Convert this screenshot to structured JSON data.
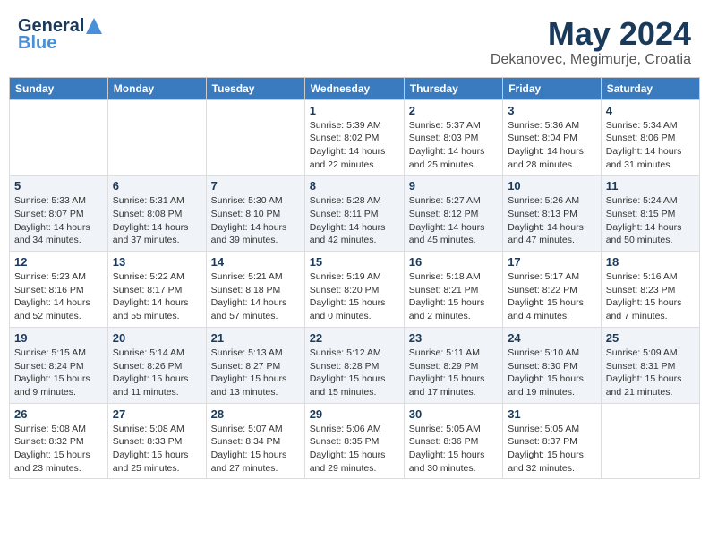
{
  "header": {
    "logo": {
      "line1": "General",
      "line2": "Blue"
    },
    "title": "May 2024",
    "location": "Dekanovec, Megimurje, Croatia"
  },
  "weekdays": [
    "Sunday",
    "Monday",
    "Tuesday",
    "Wednesday",
    "Thursday",
    "Friday",
    "Saturday"
  ],
  "weeks": [
    [
      {
        "day": "",
        "info": ""
      },
      {
        "day": "",
        "info": ""
      },
      {
        "day": "",
        "info": ""
      },
      {
        "day": "1",
        "info": "Sunrise: 5:39 AM\nSunset: 8:02 PM\nDaylight: 14 hours\nand 22 minutes."
      },
      {
        "day": "2",
        "info": "Sunrise: 5:37 AM\nSunset: 8:03 PM\nDaylight: 14 hours\nand 25 minutes."
      },
      {
        "day": "3",
        "info": "Sunrise: 5:36 AM\nSunset: 8:04 PM\nDaylight: 14 hours\nand 28 minutes."
      },
      {
        "day": "4",
        "info": "Sunrise: 5:34 AM\nSunset: 8:06 PM\nDaylight: 14 hours\nand 31 minutes."
      }
    ],
    [
      {
        "day": "5",
        "info": "Sunrise: 5:33 AM\nSunset: 8:07 PM\nDaylight: 14 hours\nand 34 minutes."
      },
      {
        "day": "6",
        "info": "Sunrise: 5:31 AM\nSunset: 8:08 PM\nDaylight: 14 hours\nand 37 minutes."
      },
      {
        "day": "7",
        "info": "Sunrise: 5:30 AM\nSunset: 8:10 PM\nDaylight: 14 hours\nand 39 minutes."
      },
      {
        "day": "8",
        "info": "Sunrise: 5:28 AM\nSunset: 8:11 PM\nDaylight: 14 hours\nand 42 minutes."
      },
      {
        "day": "9",
        "info": "Sunrise: 5:27 AM\nSunset: 8:12 PM\nDaylight: 14 hours\nand 45 minutes."
      },
      {
        "day": "10",
        "info": "Sunrise: 5:26 AM\nSunset: 8:13 PM\nDaylight: 14 hours\nand 47 minutes."
      },
      {
        "day": "11",
        "info": "Sunrise: 5:24 AM\nSunset: 8:15 PM\nDaylight: 14 hours\nand 50 minutes."
      }
    ],
    [
      {
        "day": "12",
        "info": "Sunrise: 5:23 AM\nSunset: 8:16 PM\nDaylight: 14 hours\nand 52 minutes."
      },
      {
        "day": "13",
        "info": "Sunrise: 5:22 AM\nSunset: 8:17 PM\nDaylight: 14 hours\nand 55 minutes."
      },
      {
        "day": "14",
        "info": "Sunrise: 5:21 AM\nSunset: 8:18 PM\nDaylight: 14 hours\nand 57 minutes."
      },
      {
        "day": "15",
        "info": "Sunrise: 5:19 AM\nSunset: 8:20 PM\nDaylight: 15 hours\nand 0 minutes."
      },
      {
        "day": "16",
        "info": "Sunrise: 5:18 AM\nSunset: 8:21 PM\nDaylight: 15 hours\nand 2 minutes."
      },
      {
        "day": "17",
        "info": "Sunrise: 5:17 AM\nSunset: 8:22 PM\nDaylight: 15 hours\nand 4 minutes."
      },
      {
        "day": "18",
        "info": "Sunrise: 5:16 AM\nSunset: 8:23 PM\nDaylight: 15 hours\nand 7 minutes."
      }
    ],
    [
      {
        "day": "19",
        "info": "Sunrise: 5:15 AM\nSunset: 8:24 PM\nDaylight: 15 hours\nand 9 minutes."
      },
      {
        "day": "20",
        "info": "Sunrise: 5:14 AM\nSunset: 8:26 PM\nDaylight: 15 hours\nand 11 minutes."
      },
      {
        "day": "21",
        "info": "Sunrise: 5:13 AM\nSunset: 8:27 PM\nDaylight: 15 hours\nand 13 minutes."
      },
      {
        "day": "22",
        "info": "Sunrise: 5:12 AM\nSunset: 8:28 PM\nDaylight: 15 hours\nand 15 minutes."
      },
      {
        "day": "23",
        "info": "Sunrise: 5:11 AM\nSunset: 8:29 PM\nDaylight: 15 hours\nand 17 minutes."
      },
      {
        "day": "24",
        "info": "Sunrise: 5:10 AM\nSunset: 8:30 PM\nDaylight: 15 hours\nand 19 minutes."
      },
      {
        "day": "25",
        "info": "Sunrise: 5:09 AM\nSunset: 8:31 PM\nDaylight: 15 hours\nand 21 minutes."
      }
    ],
    [
      {
        "day": "26",
        "info": "Sunrise: 5:08 AM\nSunset: 8:32 PM\nDaylight: 15 hours\nand 23 minutes."
      },
      {
        "day": "27",
        "info": "Sunrise: 5:08 AM\nSunset: 8:33 PM\nDaylight: 15 hours\nand 25 minutes."
      },
      {
        "day": "28",
        "info": "Sunrise: 5:07 AM\nSunset: 8:34 PM\nDaylight: 15 hours\nand 27 minutes."
      },
      {
        "day": "29",
        "info": "Sunrise: 5:06 AM\nSunset: 8:35 PM\nDaylight: 15 hours\nand 29 minutes."
      },
      {
        "day": "30",
        "info": "Sunrise: 5:05 AM\nSunset: 8:36 PM\nDaylight: 15 hours\nand 30 minutes."
      },
      {
        "day": "31",
        "info": "Sunrise: 5:05 AM\nSunset: 8:37 PM\nDaylight: 15 hours\nand 32 minutes."
      },
      {
        "day": "",
        "info": ""
      }
    ]
  ]
}
